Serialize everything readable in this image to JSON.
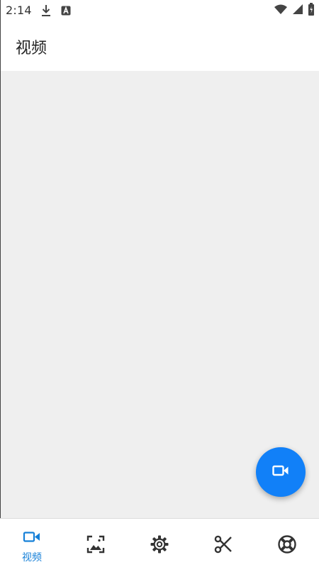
{
  "status_bar": {
    "time": "2:14",
    "left_icons": [
      "download-icon",
      "notification-a-icon"
    ],
    "right_icons": [
      "wifi-icon",
      "signal-icon",
      "battery-icon"
    ]
  },
  "app_bar": {
    "title": "视频"
  },
  "fab": {
    "icon": "videocam-icon",
    "color": "#1180f8"
  },
  "bottom_nav": {
    "active_color": "#1680d8",
    "inactive_color": "#333333",
    "items": [
      {
        "label": "视频",
        "icon": "videocam-icon",
        "active": true
      },
      {
        "label": "",
        "icon": "image-icon",
        "active": false
      },
      {
        "label": "",
        "icon": "gear-icon",
        "active": false
      },
      {
        "label": "",
        "icon": "scissors-icon",
        "active": false
      },
      {
        "label": "",
        "icon": "lifebuoy-icon",
        "active": false
      }
    ]
  }
}
